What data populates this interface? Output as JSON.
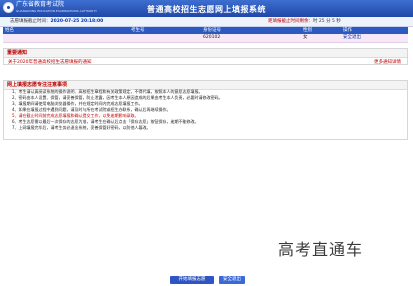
{
  "header": {
    "org_name": "广东省教育考试院",
    "org_name_en": "GUANGDONG EDUCATION EXAMINATIONS AUTHORITY",
    "system_title": "普通高校招生志愿网上填报系统"
  },
  "infobar": {
    "deadline_label": "志愿填报截止时间：",
    "deadline_value": "2020-07-25 20:18:00",
    "remaining_label": "距填报截止时间剩余：",
    "remaining_value": "时 25 分 5 秒"
  },
  "table": {
    "columns": [
      "姓名",
      "考生号",
      "身份证号",
      "性别",
      "操作"
    ],
    "row": [
      "",
      "",
      "620102",
      "女",
      "安全退出"
    ]
  },
  "notice": {
    "title": "重要通知",
    "line": "关于2020年普通高校招生志愿填报的通知",
    "more": "更多通知详情"
  },
  "guide": {
    "title": "网上填报志愿专注注意事项",
    "items": [
      "1、考生请认真阅读系统的操作说明、高校招生章程和有关政策规定，不得代填，按照本人的意愿志愿填报。",
      "2、密码由本人设置、保管，请妥善保管，防止泄露，因考生本人原因造成的后果由考生本人负责，必要时请修改密码。",
      "3、填报期间请使用电脑浏览器操作，并在规定时间内完成志愿填报工作。",
      "4、如果在填报过程中遇到问题，请及时与所在考试院或招生办联系，确认后再继续操作。",
      "5、请在截止时间前完成志愿填报和确认提交工作，以免逾期影响录取。",
      "6、考生志愿需以最后一次保存的志愿为准，请考生在确认后点击「保存志愿」按钮保存，逾期不能修改。",
      "7、上网填报完毕后，请考生务必退出系统，妥善保管好密码，以防他人篡改。"
    ]
  },
  "watermark": "高考直通车",
  "buttons": {
    "start": "开始填报志愿",
    "exit": "安全退出"
  }
}
